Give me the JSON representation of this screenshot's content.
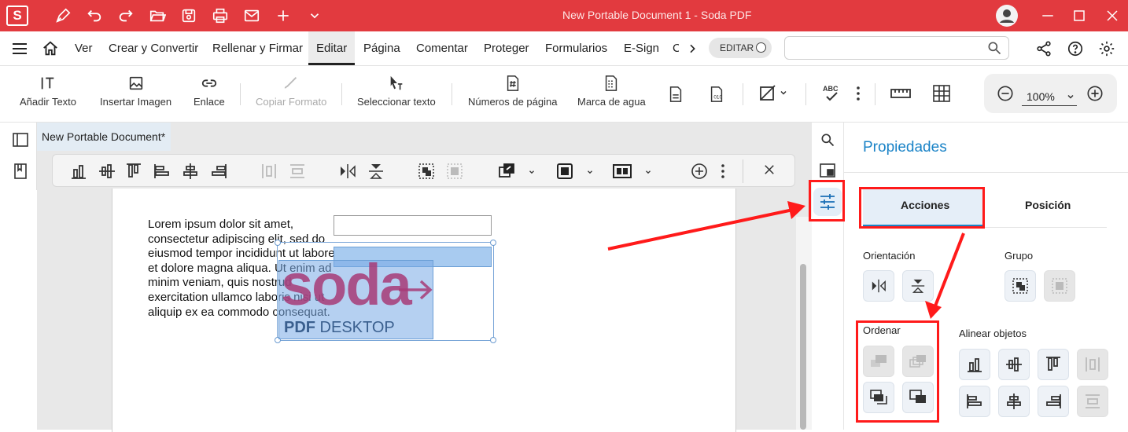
{
  "app": {
    "logo_letter": "S",
    "window_title": "New Portable Document 1   -   Soda PDF"
  },
  "menu": {
    "items": [
      "Ver",
      "Crear y Convertir",
      "Rellenar y Firmar",
      "Editar",
      "Página",
      "Comentar",
      "Proteger",
      "Formularios",
      "E-Sign",
      "C"
    ],
    "active": "Editar",
    "editar_toggle": "EDITAR"
  },
  "toolbar": {
    "add_text": "Añadir Texto",
    "insert_image": "Insertar Imagen",
    "link": "Enlace",
    "copy_format": "Copiar Formato",
    "select_text": "Seleccionar texto",
    "page_numbers": "Números de página",
    "watermark": "Marca de agua",
    "zoom": "100%"
  },
  "document": {
    "tab": "New Portable Document*",
    "lorem": "Lorem ipsum dolor sit amet, consectetur adipiscing elit, sed do eiusmod tempor incididunt ut labore et dolore magna aliqua. Ut enim ad minim veniam, quis nostrud exercitation ullamco laboris nisi ut aliquip ex ea commodo consequat.",
    "logo_word": "soda",
    "logo_sub_bold": "PDF",
    "logo_sub": " DESKTOP"
  },
  "properties": {
    "title": "Propiedades",
    "tab_actions": "Acciones",
    "tab_position": "Posición",
    "orientation": "Orientación",
    "group": "Grupo",
    "order": "Ordenar",
    "align": "Alinear objetos"
  },
  "colors": {
    "titlebar": "#e23a3f",
    "accent_blue": "#1a83c7",
    "highlight": "#ff1a1a",
    "logo_purple": "#a83b78"
  }
}
